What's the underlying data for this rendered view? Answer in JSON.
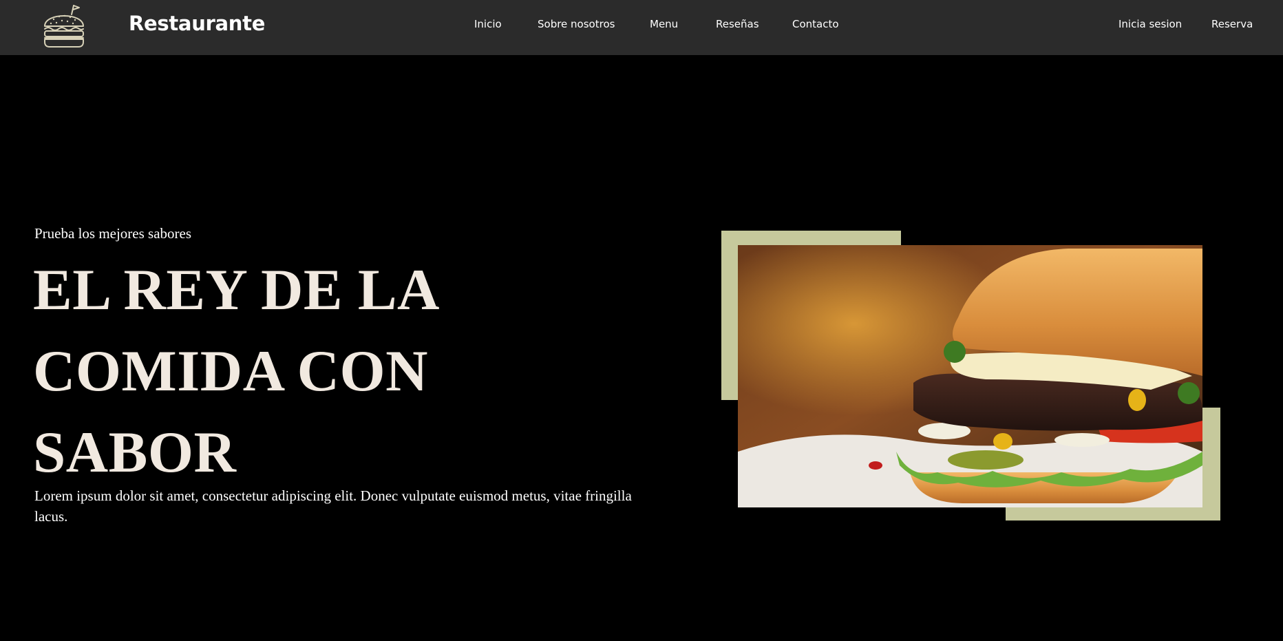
{
  "brand": {
    "name": "Restaurante",
    "logo_icon": "burger-icon"
  },
  "nav": {
    "links": [
      "Inicio",
      "Sobre nosotros",
      "Menu",
      "Reseñas",
      "Contacto"
    ],
    "login": "Inicia sesion",
    "reserve": "Reserva"
  },
  "hero": {
    "kicker": "Prueba los mejores sabores",
    "title_lines": [
      "EL REY DE LA",
      "COMIDA CON",
      "SABOR"
    ],
    "description": "Lorem ipsum dolor sit amet, consectetur adipiscing elit. Donec vulputate euismod metus, vitae fringilla lacus.",
    "image": "burger-photo"
  },
  "colors": {
    "header_bg": "#2b2b2b",
    "page_bg": "#000000",
    "accent": "#c6c99c",
    "title_text": "#f1e9e0"
  }
}
